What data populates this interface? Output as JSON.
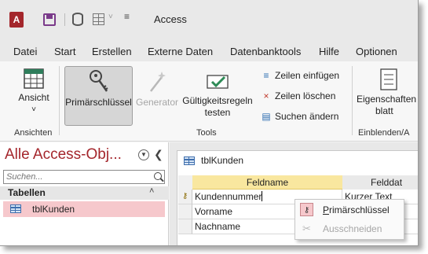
{
  "app": {
    "title": "Access",
    "logo_letter": "A"
  },
  "quick_access": {
    "more_glyph": "≡",
    "chevron": "˅"
  },
  "menu": {
    "tabs": [
      "Datei",
      "Start",
      "Erstellen",
      "Externe Daten",
      "Datenbanktools",
      "Hilfe",
      "Optionen"
    ]
  },
  "ribbon": {
    "ansicht_label": "Ansicht",
    "ansicht_dropdown": "˅",
    "group_ansichten": "Ansichten",
    "primaerschluessel_label": "Primärschlüssel",
    "generator_label": "Generator",
    "gueltigkeitsregeln_line1": "Gültigkeitsregeln",
    "gueltigkeitsregeln_line2": "testen",
    "zeilen_einfuegen": "Zeilen einfügen",
    "zeilen_loeschen": "Zeilen löschen",
    "suchen_aendern": "Suchen ändern",
    "group_tools": "Tools",
    "eigenschaften_line1": "Eigenschaften",
    "eigenschaften_line2": "blatt",
    "group_einblenden": "Einblenden/A"
  },
  "navpane": {
    "title": "Alle Access-Obj...",
    "search_placeholder": "Suchen...",
    "section": "Tabellen",
    "collapse_glyph": "˄",
    "items": [
      {
        "label": "tblKunden"
      }
    ]
  },
  "document": {
    "tab_label": "tblKunden",
    "columns": [
      "Feldname",
      "Felddat"
    ],
    "rows": [
      {
        "feldname": "Kundennummer",
        "felddatentyp": "Kurzer Text",
        "is_key": true
      },
      {
        "feldname": "Vorname",
        "felddatentyp": "",
        "is_key": false
      },
      {
        "feldname": "Nachname",
        "felddatentyp": "",
        "is_key": false
      }
    ]
  },
  "context_menu": {
    "items": [
      {
        "label_first": "P",
        "label_rest": "rimärschlüssel",
        "enabled": true
      },
      {
        "label_first": "Ausschneiden",
        "label_rest": "",
        "enabled": false
      }
    ]
  },
  "colors": {
    "accent": "#a4262c",
    "selection": "#f6c8cc",
    "header_yellow": "#f9e79f"
  }
}
